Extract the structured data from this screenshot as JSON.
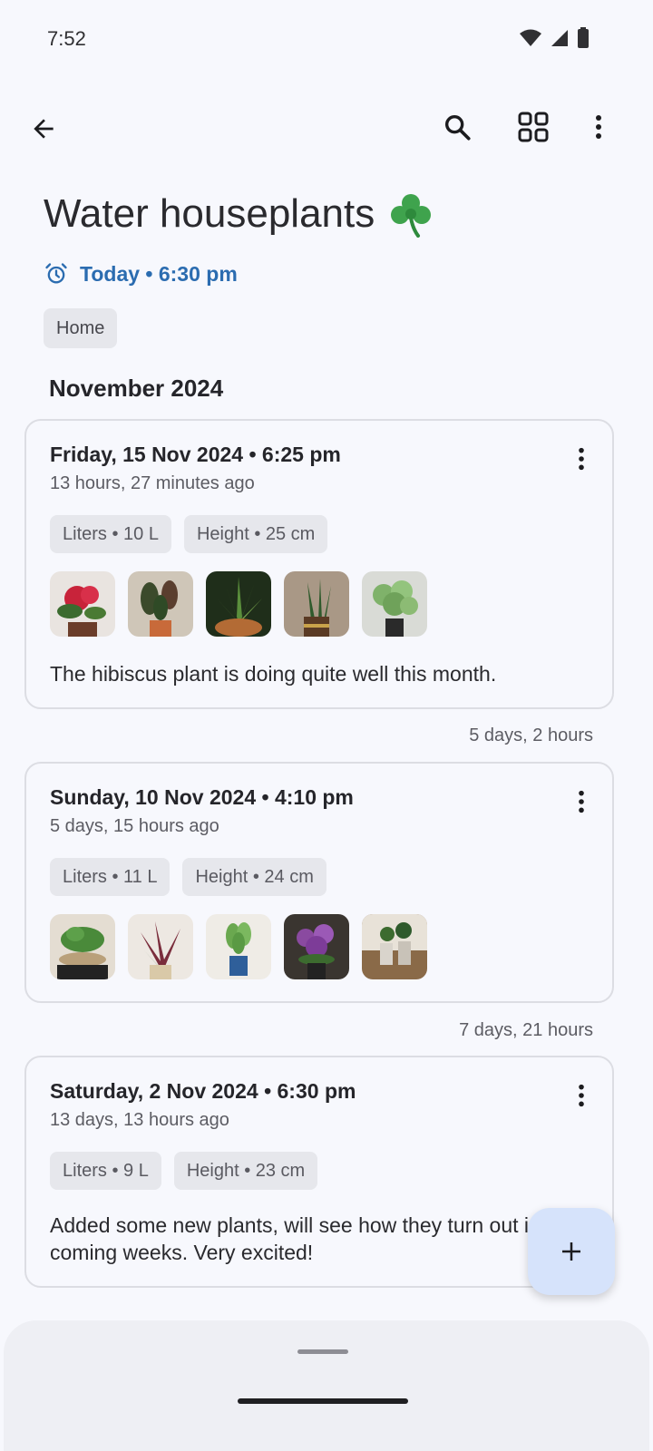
{
  "status_bar": {
    "time": "7:52"
  },
  "app_bar": {
    "back_icon": "arrow-back-icon",
    "search_icon": "search-icon",
    "view_icon": "grid-view-icon",
    "more_icon": "more-vert-icon"
  },
  "task": {
    "title": "Water houseplants",
    "title_emoji": "☘️",
    "reminder": "Today • 6:30 pm",
    "tag": "Home"
  },
  "month_header": "November 2024",
  "entries": [
    {
      "date": "Friday, 15 Nov 2024 • 6:25 pm",
      "ago": "13 hours, 27 minutes ago",
      "chips": [
        "Liters • 10 L",
        "Height • 25 cm"
      ],
      "note": "The hibiscus plant is doing quite well this month.",
      "photo_count": 5
    },
    {
      "date": "Sunday, 10 Nov 2024 • 4:10 pm",
      "ago": "5 days, 15 hours ago",
      "chips": [
        "Liters • 11 L",
        "Height • 24 cm"
      ],
      "note": "",
      "photo_count": 5
    },
    {
      "date": "Saturday, 2 Nov 2024 • 6:30 pm",
      "ago": "13 days, 13 hours ago",
      "chips": [
        "Liters • 9 L",
        "Height • 23 cm"
      ],
      "note": "Added some new plants, will see how they turn out in the coming weeks. Very excited!",
      "photo_count": 0
    }
  ],
  "gaps": [
    "5 days, 2 hours",
    "7 days, 21 hours"
  ],
  "fab": {
    "icon": "add-icon"
  },
  "colors": {
    "accent": "#2b6cb0",
    "fab_bg": "#d6e3fb",
    "chip_bg": "#e6e7ec"
  }
}
